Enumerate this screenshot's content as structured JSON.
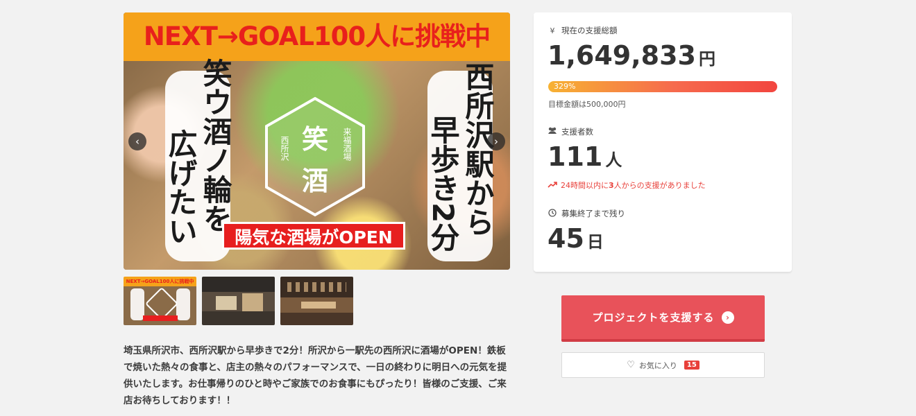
{
  "hero": {
    "banner_text": "NEXT→GOAL100人に挑戦中",
    "left_panel": [
      "笑ウ酒ノ輪を",
      "広げたい"
    ],
    "right_panel": [
      "西所沢駅から",
      "早歩き2分"
    ],
    "logo": {
      "main_top": "笑",
      "main_bottom": "酒",
      "left_small": "西所沢",
      "right_small": "来福酒場"
    },
    "open_sign": "陽気な酒場がOPEN",
    "prev_icon": "‹",
    "next_icon": "›"
  },
  "description": "埼玉県所沢市、西所沢駅から早歩きで2分！所沢から一駅先の西所沢に酒場がOPEN！鉄板で焼いた熱々の食事と、店主の熱々のパフォーマンスで、一日の終わりに明日への元気を提供いたします。お仕事帰りのひと時やご家族でのお食事にもぴったり！皆様のご支援、ご来店お待ちしております！！",
  "funding": {
    "label": "現在の支援総額",
    "icon": "yen-icon",
    "amount": "1,649,833",
    "unit": "円",
    "percent_text": "329%",
    "percent_value": 329,
    "goal_text": "目標金額は500,000円"
  },
  "supporters": {
    "label": "支援者数",
    "icon": "users-icon",
    "count": "111",
    "unit": "人",
    "recent_prefix": "24時間以内に",
    "recent_count": "3",
    "recent_suffix": "人からの支援がありました"
  },
  "remaining": {
    "label": "募集終了まで残り",
    "icon": "clock-icon",
    "days": "45",
    "unit": "日"
  },
  "actions": {
    "support_label": "プロジェクトを支援する",
    "favorite_label": "お気に入り",
    "favorite_count": "15"
  },
  "colors": {
    "accent": "#e8525a",
    "alert": "#e8403a",
    "progress_start": "#f7b233",
    "progress_end": "#f2453f"
  }
}
